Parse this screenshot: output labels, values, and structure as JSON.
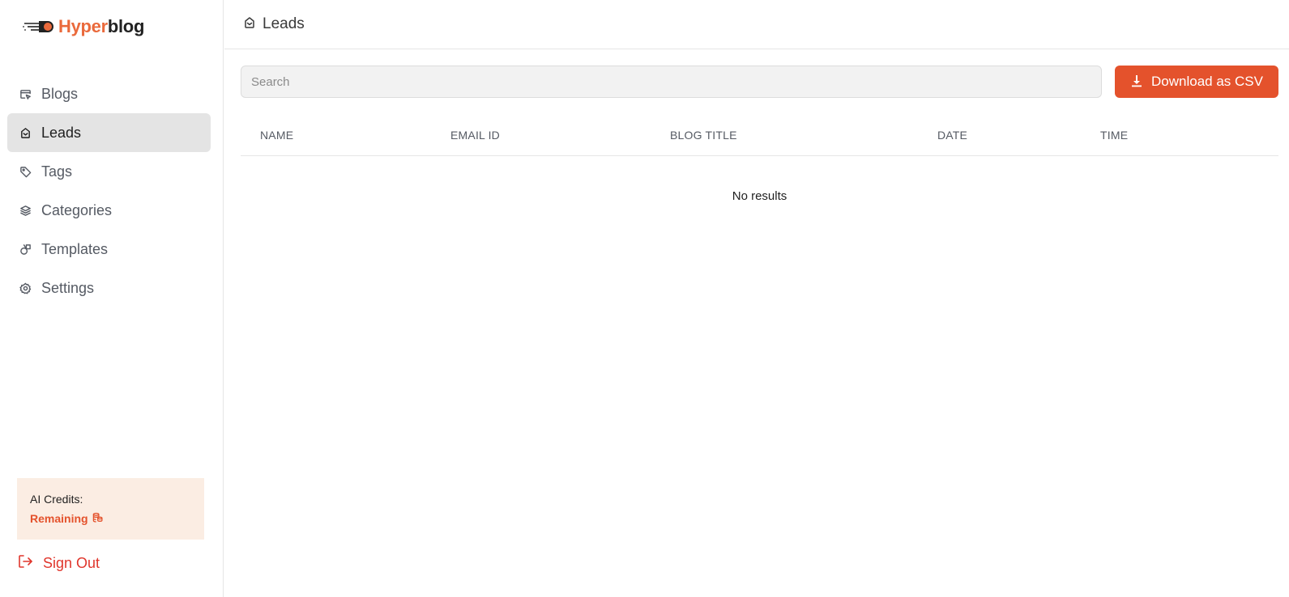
{
  "brand": {
    "part1": "Hyper",
    "part2": "blog",
    "accent": "#ea6a3c"
  },
  "sidebar": {
    "items": [
      {
        "label": "Blogs",
        "icon": "blogs-icon",
        "active": false
      },
      {
        "label": "Leads",
        "icon": "leads-icon",
        "active": true
      },
      {
        "label": "Tags",
        "icon": "tag-icon",
        "active": false
      },
      {
        "label": "Categories",
        "icon": "layers-icon",
        "active": false
      },
      {
        "label": "Templates",
        "icon": "templates-icon",
        "active": false
      },
      {
        "label": "Settings",
        "icon": "gear-icon",
        "active": false
      }
    ],
    "credits": {
      "title": "AI Credits:",
      "remaining": "Remaining",
      "icon": "coins-icon"
    },
    "signout": {
      "label": "Sign Out",
      "icon": "sign-out-icon"
    }
  },
  "header": {
    "title": "Leads",
    "icon": "leads-icon"
  },
  "toolbar": {
    "search_placeholder": "Search",
    "search_value": "",
    "download_label": "Download as CSV",
    "download_icon": "download-icon",
    "button_color": "#e4522c"
  },
  "table": {
    "columns": [
      "NAME",
      "EMAIL ID",
      "BLOG TITLE",
      "DATE",
      "TIME"
    ],
    "rows": [],
    "empty_text": "No results"
  }
}
